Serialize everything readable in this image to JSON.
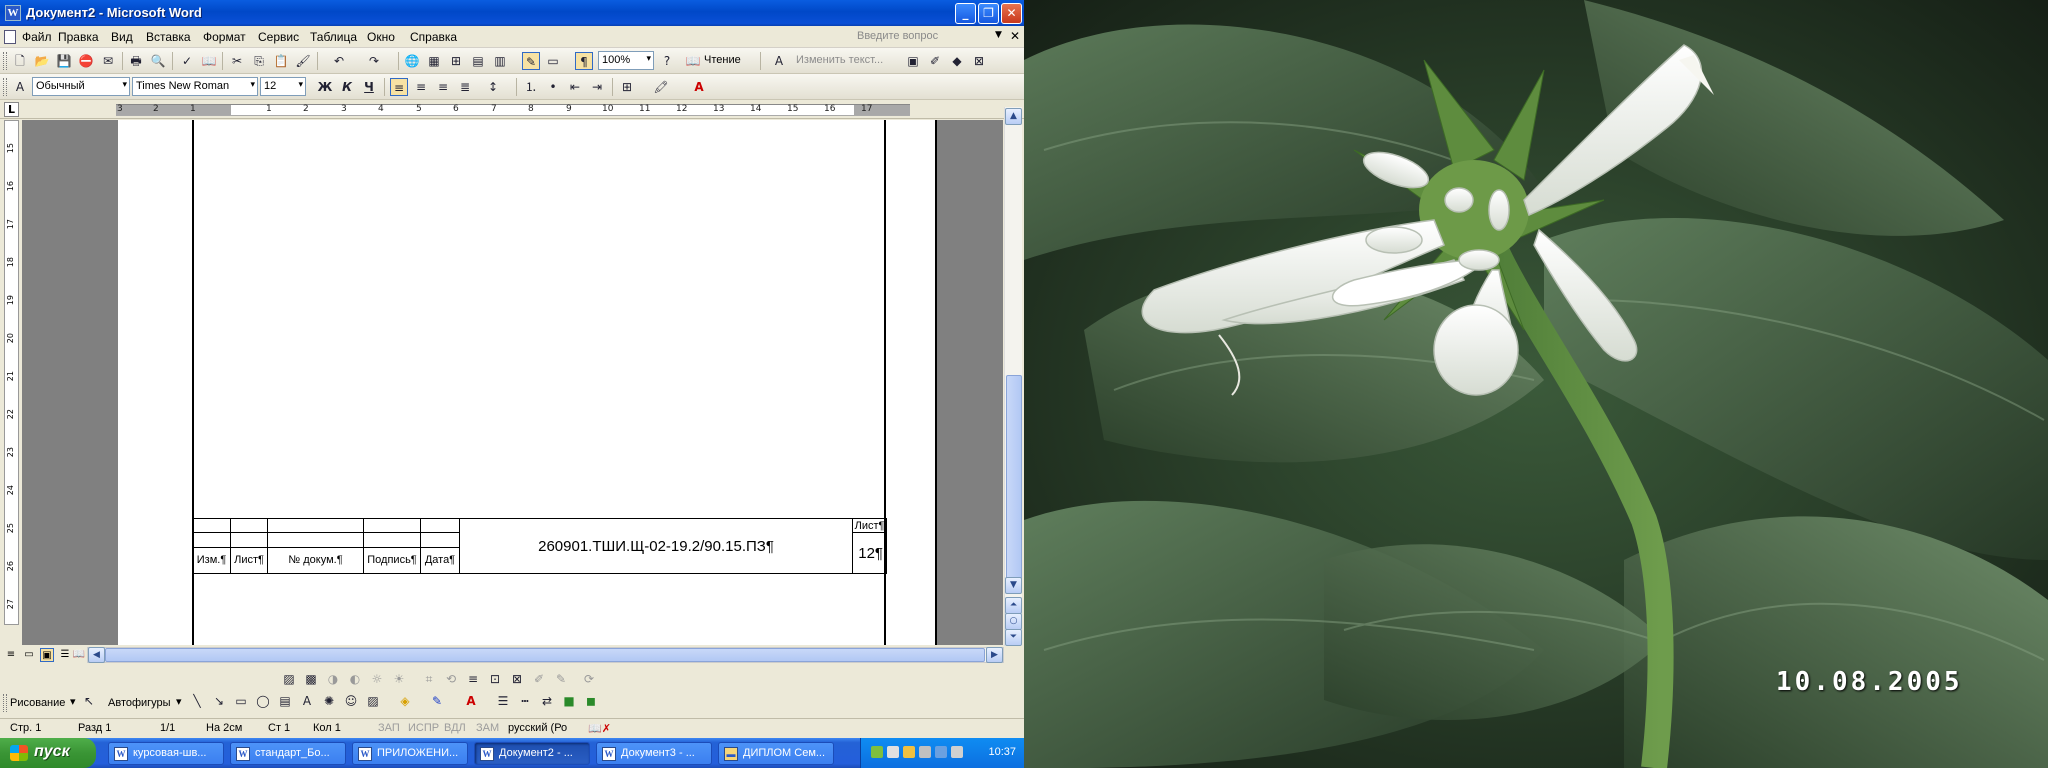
{
  "window": {
    "title": "Документ2 - Microsoft Word",
    "app_icon": "W",
    "buttons": [
      "_",
      "❐",
      "✕"
    ]
  },
  "menu": {
    "items": [
      "Файл",
      "Правка",
      "Вид",
      "Вставка",
      "Формат",
      "Сервис",
      "Таблица",
      "Окно",
      "Справка"
    ],
    "help_placeholder": "Введите вопрос"
  },
  "toolbar_standard": {
    "zoom": "100%",
    "reading": "Чтение",
    "change_text": "Изменить текст..."
  },
  "toolbar_format": {
    "style": "Обычный",
    "font": "Times New Roman",
    "size": "12",
    "bold": "Ж",
    "italic": "К",
    "underline": "Ч"
  },
  "ruler": {
    "corner": "L",
    "h_marks": [
      "3",
      "2",
      "1",
      "1",
      "2",
      "3",
      "4",
      "5",
      "6",
      "7",
      "8",
      "9",
      "10",
      "11",
      "12",
      "13",
      "14",
      "15",
      "16",
      "17"
    ],
    "v_marks": [
      "15",
      "16",
      "17",
      "18",
      "19",
      "20",
      "21",
      "22",
      "23",
      "24",
      "25",
      "26",
      "27"
    ]
  },
  "document": {
    "title_block": {
      "doc_code": "260901.ТШИ.Щ-02-19.2/90.15.ПЗ¶",
      "sheet_label": "Лист¶",
      "page_number": "12¶",
      "headers": [
        "Изм.¶",
        "Лист¶",
        "№ докум.¶",
        "Подпись¶",
        "Дата¶"
      ]
    }
  },
  "drawing_toolbar": {
    "drawing": "Рисование",
    "autoshapes": "Автофигуры"
  },
  "status": {
    "page": "Стр. 1",
    "section": "Разд 1",
    "pages": "1/1",
    "at": "На 2см",
    "line": "Ст 1",
    "col": "Кол 1",
    "rec": "ЗАП",
    "trk": "ИСПР",
    "ext": "ВДЛ",
    "ovr": "ЗАМ",
    "language": "русский (Ро"
  },
  "taskbar": {
    "start": "пуск",
    "tasks": [
      "курсовая-шв...",
      "стандарт_Бо...",
      "ПРИЛОЖЕНИ...",
      "Документ2 - ...",
      "Документ3 - ...",
      "ДИПЛОМ Сем..."
    ],
    "active_index": 3,
    "clock": "10:37"
  },
  "photo": {
    "date_stamp": "10.08.2005"
  },
  "colors": {
    "titlebar": "#0a5de0",
    "taskbar": "#245edb",
    "start_green": "#3a9535",
    "leaf_dark": "#2b3d2b",
    "flower_white": "#f2f4f0"
  }
}
